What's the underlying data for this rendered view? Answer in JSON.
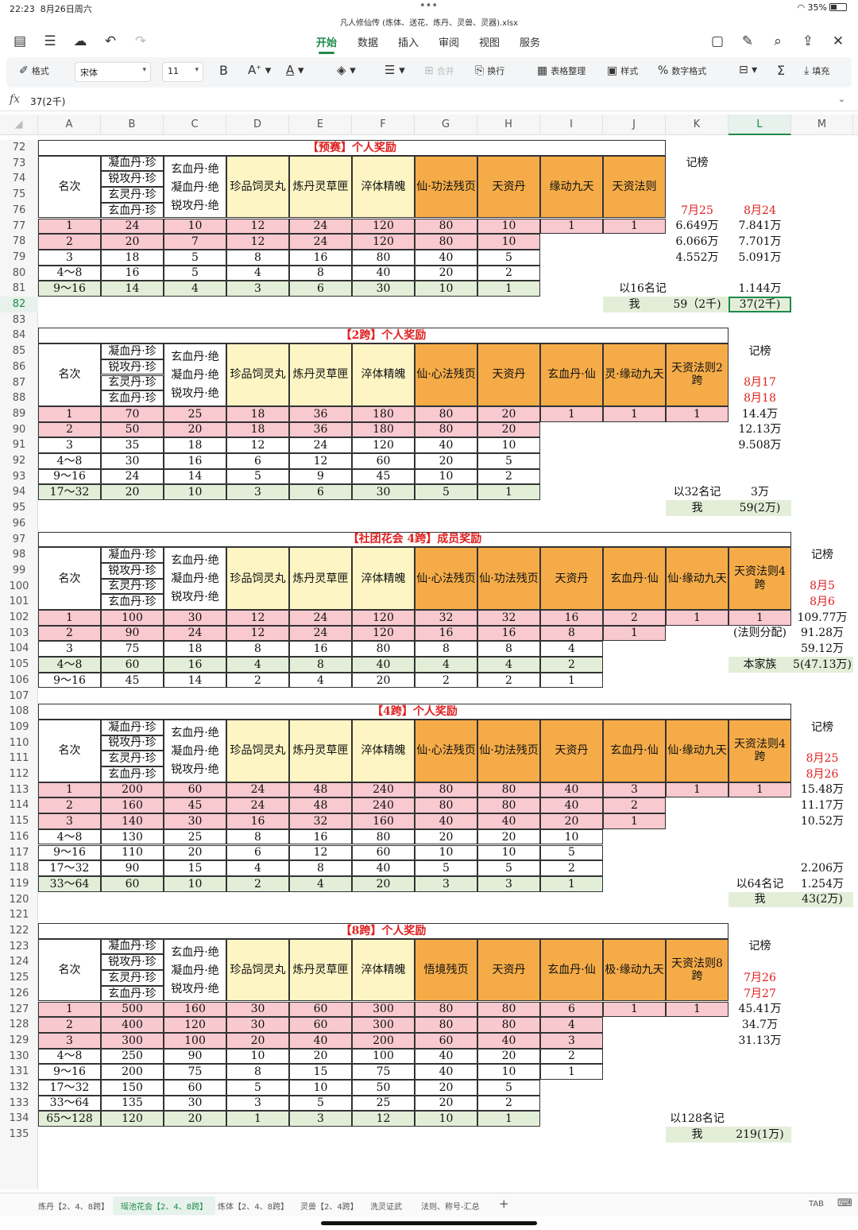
{
  "status": {
    "time": "22:23",
    "date": "8月26日周六",
    "dots": "•••",
    "battery": "35%"
  },
  "doc_title": "凡人修仙传 (炼体、送花、炼丹、灵兽、灵器).xlsx",
  "menu_tabs": [
    "开始",
    "数据",
    "插入",
    "审阅",
    "视图",
    "服务"
  ],
  "toolbar": {
    "format": "格式",
    "font": "宋体",
    "size": "11",
    "bold": "B",
    "merge": "合并",
    "wrap": "换行",
    "table_tidy": "表格整理",
    "style": "样式",
    "number_format": "数字格式",
    "fill": "填充"
  },
  "formula": {
    "fx": "fx",
    "value": "37(2千)"
  },
  "columns": [
    "A",
    "B",
    "C",
    "D",
    "E",
    "F",
    "G",
    "H",
    "I",
    "J",
    "K",
    "L",
    "M"
  ],
  "rows": [
    "72",
    "73",
    "74",
    "75",
    "76",
    "77",
    "78",
    "79",
    "80",
    "81",
    "82",
    "83",
    "84",
    "85",
    "86",
    "87",
    "88",
    "89",
    "90",
    "91",
    "92",
    "93",
    "94",
    "95",
    "96",
    "97",
    "98",
    "99",
    "100",
    "101",
    "102",
    "103",
    "104",
    "105",
    "106",
    "107",
    "108",
    "109",
    "110",
    "111",
    "112",
    "113",
    "114",
    "115",
    "116",
    "117",
    "118",
    "119",
    "120",
    "121",
    "122",
    "123",
    "124",
    "125",
    "126",
    "127",
    "128",
    "129",
    "130",
    "131",
    "132",
    "133",
    "134",
    "135"
  ],
  "t1": {
    "title": "【预赛】个人奖励",
    "headers": {
      "rank": "名次",
      "b": [
        "凝血丹·珍",
        "锐攻丹·珍",
        "玄灵丹·珍",
        "玄血丹·珍"
      ],
      "c": [
        "玄血丹·绝",
        "凝血丹·绝",
        "锐攻丹·绝"
      ],
      "d": "珍品饲灵丸",
      "e": "炼丹灵草匣",
      "f": "淬体精魄",
      "g": "仙·功法残页",
      "h": "天资丹",
      "i": "缘动九天",
      "j": "天资法则"
    },
    "rows": [
      [
        "1",
        "24",
        "10",
        "12",
        "24",
        "120",
        "80",
        "10",
        "1",
        "1"
      ],
      [
        "2",
        "20",
        "7",
        "12",
        "24",
        "120",
        "80",
        "10"
      ],
      [
        "3",
        "18",
        "5",
        "8",
        "16",
        "80",
        "40",
        "5"
      ],
      [
        "4～8",
        "16",
        "5",
        "4",
        "8",
        "40",
        "20",
        "2"
      ],
      [
        "9～16",
        "14",
        "4",
        "3",
        "6",
        "30",
        "10",
        "1"
      ]
    ],
    "side": {
      "label": "记榜",
      "d1": "7月25",
      "d2": "8月24",
      "k": [
        "6.649万",
        "6.066万",
        "4.552万"
      ],
      "l": [
        "7.841万",
        "7.701万",
        "5.091万",
        "1.144万"
      ],
      "note": "以16名记",
      "me": "我",
      "me_k": "59（2千)",
      "me_l": "37(2千)"
    }
  },
  "t2": {
    "title": "【2跨】个人奖励",
    "headers": {
      "rank": "名次",
      "b": [
        "凝血丹·珍",
        "锐攻丹·珍",
        "玄灵丹·珍",
        "玄血丹·珍"
      ],
      "c": [
        "玄血丹·绝",
        "凝血丹·绝",
        "锐攻丹·绝"
      ],
      "d": "珍品饲灵丸",
      "e": "炼丹灵草匣",
      "f": "淬体精魄",
      "g": "仙·心法残页",
      "h": "天资丹",
      "i": "玄血丹·仙",
      "j": "灵·缘动九天",
      "k": "天资法则2跨"
    },
    "rows": [
      [
        "1",
        "70",
        "25",
        "18",
        "36",
        "180",
        "80",
        "20",
        "1",
        "1",
        "1"
      ],
      [
        "2",
        "50",
        "20",
        "18",
        "36",
        "180",
        "80",
        "20"
      ],
      [
        "3",
        "35",
        "18",
        "12",
        "24",
        "120",
        "40",
        "10"
      ],
      [
        "4～8",
        "30",
        "16",
        "6",
        "12",
        "60",
        "20",
        "5"
      ],
      [
        "9～16",
        "24",
        "14",
        "5",
        "9",
        "45",
        "10",
        "2"
      ],
      [
        "17～32",
        "20",
        "10",
        "3",
        "6",
        "30",
        "5",
        "1"
      ]
    ],
    "side": {
      "label": "记榜",
      "d1": "8月17",
      "d2": "8月18",
      "l": [
        "14.4万",
        "12.13万",
        "9.508万",
        "3万"
      ],
      "note": "以32名记",
      "me": "我",
      "me_l": "59(2万)"
    }
  },
  "t3": {
    "title": "【社团花会 4跨】成员奖励",
    "headers": {
      "rank": "名次",
      "b": [
        "凝血丹·珍",
        "锐攻丹·珍",
        "玄灵丹·珍",
        "玄血丹·珍"
      ],
      "c": [
        "玄血丹·绝",
        "凝血丹·绝",
        "锐攻丹·绝"
      ],
      "d": "珍品饲灵丸",
      "e": "炼丹灵草匣",
      "f": "淬体精魄",
      "g": "仙·心法残页",
      "h": "仙·功法残页",
      "i": "天资丹",
      "j": "玄血丹·仙",
      "k": "仙·缘动九天",
      "l": "天资法则4跨"
    },
    "rows": [
      [
        "1",
        "100",
        "30",
        "12",
        "24",
        "120",
        "32",
        "32",
        "16",
        "2",
        "1",
        "1"
      ],
      [
        "2",
        "90",
        "24",
        "12",
        "24",
        "120",
        "16",
        "16",
        "8",
        "1"
      ],
      [
        "3",
        "75",
        "18",
        "8",
        "16",
        "80",
        "8",
        "8",
        "4"
      ],
      [
        "4～8",
        "60",
        "16",
        "4",
        "8",
        "40",
        "4",
        "4",
        "2"
      ],
      [
        "9～16",
        "45",
        "14",
        "2",
        "4",
        "20",
        "2",
        "2",
        "1"
      ]
    ],
    "side": {
      "label": "记榜",
      "d1": "8月5",
      "d2": "8月6",
      "m": [
        "109.77万",
        "91.28万",
        "59.12万",
        "5(47.13万)"
      ],
      "note": "(法则分配)",
      "clan": "本家族"
    }
  },
  "t4": {
    "title": "【4跨】个人奖励",
    "headers": {
      "rank": "名次",
      "b": [
        "凝血丹·珍",
        "锐攻丹·珍",
        "玄灵丹·珍",
        "玄血丹·珍"
      ],
      "c": [
        "玄血丹·绝",
        "凝血丹·绝",
        "锐攻丹·绝"
      ],
      "d": "珍品饲灵丸",
      "e": "炼丹灵草匣",
      "f": "淬体精魄",
      "g": "仙·心法残页",
      "h": "仙·功法残页",
      "i": "天资丹",
      "j": "玄血丹·仙",
      "k": "仙·缘动九天",
      "l": "天资法则4跨"
    },
    "rows": [
      [
        "1",
        "200",
        "60",
        "24",
        "48",
        "240",
        "80",
        "80",
        "40",
        "3",
        "1",
        "1"
      ],
      [
        "2",
        "160",
        "45",
        "24",
        "48",
        "240",
        "80",
        "80",
        "40",
        "2"
      ],
      [
        "3",
        "140",
        "30",
        "16",
        "32",
        "160",
        "40",
        "40",
        "20",
        "1"
      ],
      [
        "4～8",
        "130",
        "25",
        "8",
        "16",
        "80",
        "20",
        "20",
        "10"
      ],
      [
        "9～16",
        "110",
        "20",
        "6",
        "12",
        "60",
        "10",
        "10",
        "5"
      ],
      [
        "17～32",
        "90",
        "15",
        "4",
        "8",
        "40",
        "5",
        "5",
        "2"
      ],
      [
        "33～64",
        "60",
        "10",
        "2",
        "4",
        "20",
        "3",
        "3",
        "1"
      ]
    ],
    "side": {
      "label": "记榜",
      "d1": "8月25",
      "d2": "8月26",
      "m": [
        "15.48万",
        "11.17万",
        "10.52万",
        "2.206万",
        "1.254万"
      ],
      "note": "以64名记",
      "me": "我",
      "me_m": "43(2万)"
    }
  },
  "t5": {
    "title": "【8跨】个人奖励",
    "headers": {
      "rank": "名次",
      "b": [
        "凝血丹·珍",
        "锐攻丹·珍",
        "玄灵丹·珍",
        "玄血丹·珍"
      ],
      "c": [
        "玄血丹·绝",
        "凝血丹·绝",
        "锐攻丹·绝"
      ],
      "d": "珍品饲灵丸",
      "e": "炼丹灵草匣",
      "f": "淬体精魄",
      "g": "悟境残页",
      "h": "天资丹",
      "i": "玄血丹·仙",
      "j": "极·缘动九天",
      "k": "天资法则8跨"
    },
    "rows": [
      [
        "1",
        "500",
        "160",
        "30",
        "60",
        "300",
        "80",
        "80",
        "6",
        "1",
        "1"
      ],
      [
        "2",
        "400",
        "120",
        "30",
        "60",
        "300",
        "80",
        "80",
        "4"
      ],
      [
        "3",
        "300",
        "100",
        "20",
        "40",
        "200",
        "60",
        "40",
        "3"
      ],
      [
        "4～8",
        "250",
        "90",
        "10",
        "20",
        "100",
        "40",
        "20",
        "2"
      ],
      [
        "9～16",
        "200",
        "75",
        "8",
        "15",
        "75",
        "40",
        "10",
        "1"
      ],
      [
        "17～32",
        "150",
        "60",
        "5",
        "10",
        "50",
        "20",
        "5"
      ],
      [
        "33～64",
        "135",
        "30",
        "3",
        "5",
        "25",
        "20",
        "2"
      ],
      [
        "65～128",
        "120",
        "20",
        "1",
        "3",
        "12",
        "10",
        "1"
      ]
    ],
    "side": {
      "label": "记榜",
      "d1": "7月26",
      "d2": "7月27",
      "l": [
        "45.41万",
        "34.7万",
        "31.13万"
      ],
      "note": "以128名记",
      "me": "我",
      "me_l": "219(1万)"
    }
  },
  "sheet_tabs": [
    "炼丹【2、4、8跨】",
    "瑶池花会【2、4、8跨】",
    "炼体【2、4、8跨】",
    "灵兽【2、4跨】",
    "洗灵证武",
    "法则、称号-汇总"
  ],
  "sheet_add": "+",
  "tab_key": "TAB"
}
